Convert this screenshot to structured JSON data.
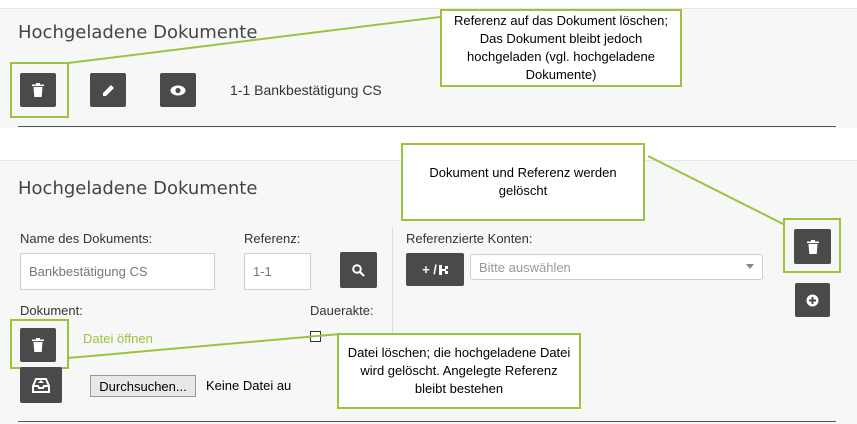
{
  "top_section": {
    "title": "Hochgeladene Dokumente",
    "document_entry": "1-1 Bankbestätigung CS",
    "buttons": {
      "delete_icon": "trash-icon",
      "edit_icon": "pencil-icon",
      "view_icon": "eye-icon"
    }
  },
  "bottom_section": {
    "title": "Hochgeladene Dokumente",
    "name_label": "Name des Dokuments:",
    "name_value": "Bankbestätigung CS",
    "referenz_label": "Referenz:",
    "referenz_value": "1-1",
    "konten_label": "Referenzierte Konten:",
    "konten_add_button": "+ /",
    "konten_placeholder": "Bitte auswählen",
    "dokument_label": "Dokument:",
    "datei_oeffnen": "Datei öffnen",
    "dauerakte_label": "Dauerakte:",
    "browse_button": "Durchsuchen...",
    "no_file": "Keine Datei au"
  },
  "callouts": {
    "top": "Referenz auf das Dokument löschen; Das Dokument bleibt jedoch hochgeladen (vgl. hochgeladene Dokumente)",
    "middle": "Dokument  und Referenz werden gelöscht",
    "bottom": "Datei löschen; die hochgeladene Datei wird gelöscht. Angelegte Referenz bleibt bestehen"
  },
  "colors": {
    "accent_green": "#9bc33e",
    "button_dark": "#4a4a4a",
    "panel_bg": "#f7f7f7",
    "link_green": "#9bc33e"
  }
}
